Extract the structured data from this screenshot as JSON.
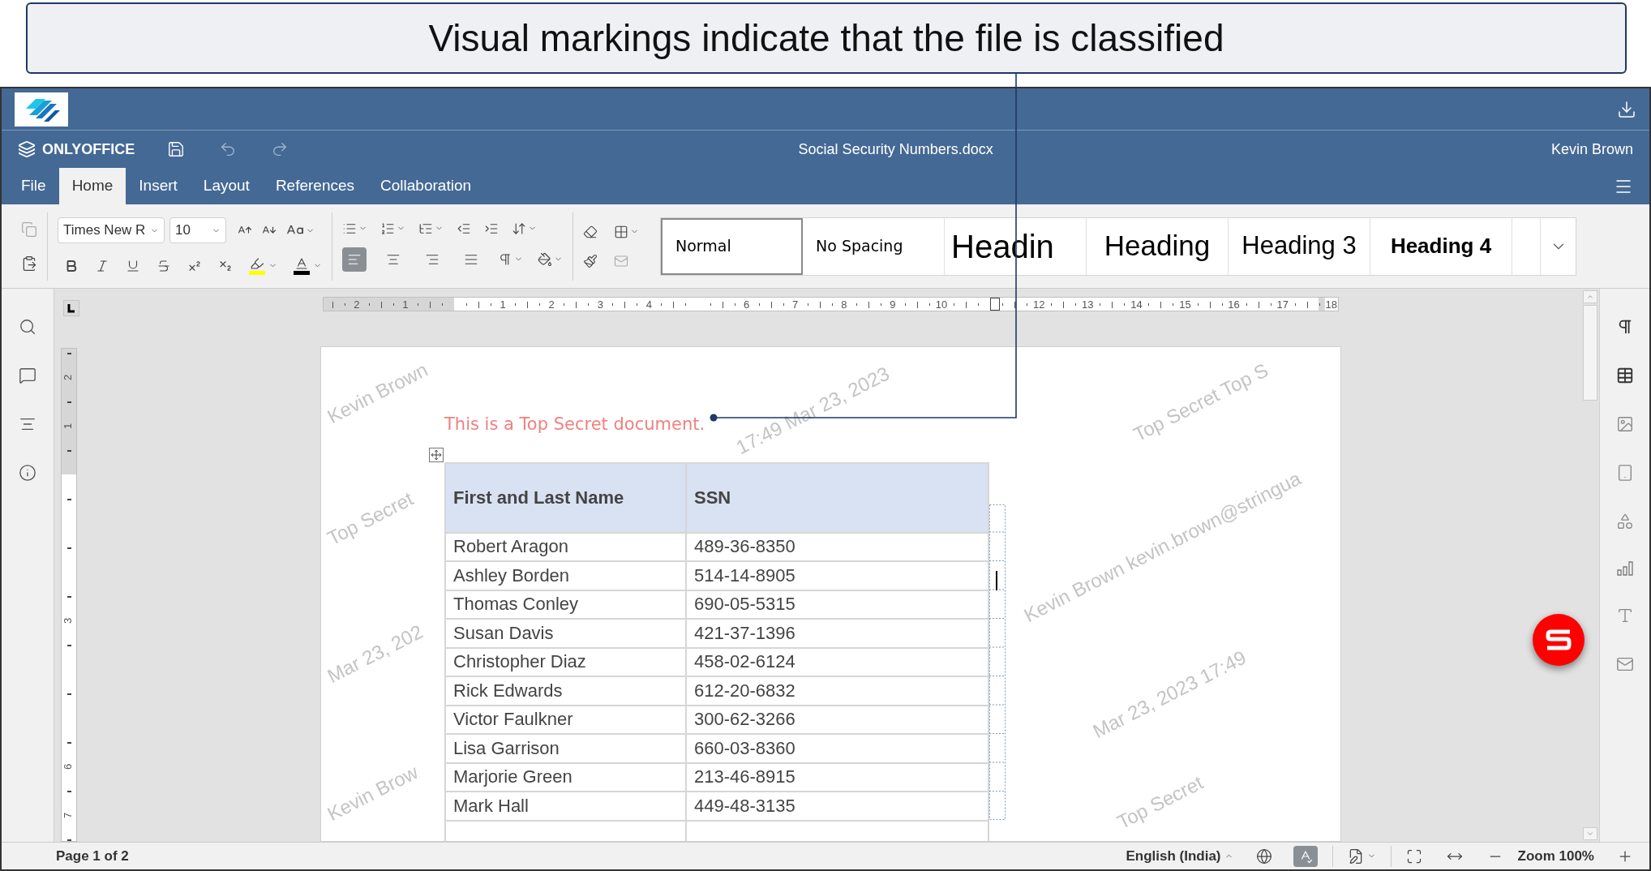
{
  "callout": {
    "text": "Visual markings indicate that the file is classified"
  },
  "header": {
    "product": "ONLYOFFICE",
    "document_title": "Social Security Numbers.docx",
    "user": "Kevin Brown"
  },
  "tabs": [
    {
      "label": "File",
      "selected": false
    },
    {
      "label": "Home",
      "selected": true
    },
    {
      "label": "Insert",
      "selected": false
    },
    {
      "label": "Layout",
      "selected": false
    },
    {
      "label": "References",
      "selected": false
    },
    {
      "label": "Collaboration",
      "selected": false
    }
  ],
  "toolbar": {
    "font_name": "Times New R",
    "font_size": "10",
    "alignment": [
      {
        "kind": "left",
        "selected": true
      },
      {
        "kind": "center",
        "selected": false
      },
      {
        "kind": "right",
        "selected": false
      },
      {
        "kind": "justify",
        "selected": false
      }
    ],
    "styles": [
      {
        "label": "Normal",
        "kind": "normal",
        "selected": true
      },
      {
        "label": "No Spacing",
        "kind": "no_spacing",
        "selected": false
      },
      {
        "label": "Headin",
        "kind": "heading1",
        "selected": false
      },
      {
        "label": "Heading",
        "kind": "heading2",
        "selected": false
      },
      {
        "label": "Heading 3",
        "kind": "heading3",
        "selected": false
      },
      {
        "label": "Heading 4",
        "kind": "heading4",
        "selected": false
      }
    ]
  },
  "rulers": {
    "top": {
      "negative": [
        "2",
        "1"
      ],
      "positive": [
        "1",
        "2",
        "3",
        "4",
        "6",
        "7",
        "8",
        "9",
        "10",
        "12",
        "13",
        "14",
        "15",
        "16",
        "17",
        "18"
      ]
    },
    "left": {
      "negative": [
        "2",
        "1"
      ],
      "positive": [
        "3",
        "6",
        "7"
      ]
    }
  },
  "document": {
    "note": "This is a Top Secret document.",
    "watermark_lines": [
      "Kevin Brown",
      "Top Secret",
      "Mar 23, 202",
      "Kevin Brow",
      "17:49 Mar 23, 2023",
      "Top Secret Top S",
      "Kevin Brown kevin.brown@stringua",
      "Mar 23, 2023 17:49",
      "Top Secret"
    ],
    "table": {
      "columns": [
        "First and Last Name",
        "SSN"
      ],
      "rows": [
        [
          "Robert Aragon",
          "489-36-8350"
        ],
        [
          "Ashley Borden",
          "514-14-8905"
        ],
        [
          "Thomas Conley",
          "690-05-5315"
        ],
        [
          "Susan Davis",
          "421-37-1396"
        ],
        [
          "Christopher Diaz",
          "458-02-6124"
        ],
        [
          "Rick Edwards",
          "612-20-6832"
        ],
        [
          "Victor Faulkner",
          "300-62-3266"
        ],
        [
          "Lisa Garrison",
          "660-03-8360"
        ],
        [
          "Marjorie Green",
          "213-46-8915"
        ],
        [
          "Mark Hall",
          "449-48-3135"
        ]
      ]
    }
  },
  "status_bar": {
    "page": "Page 1 of 2",
    "language": "English (India)",
    "spell_check": true,
    "zoom": "Zoom 100%"
  }
}
